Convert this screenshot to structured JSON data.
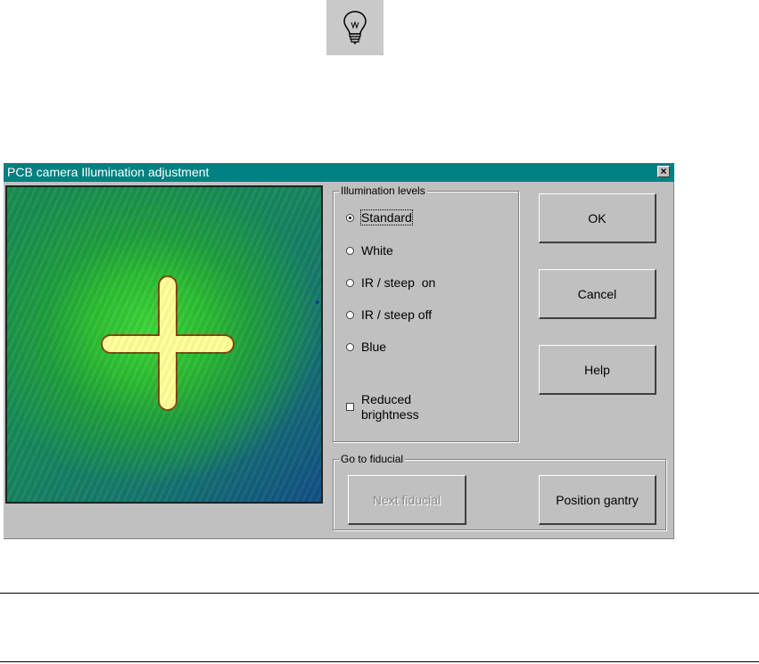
{
  "toolbar": {
    "icon": "light-bulb-icon"
  },
  "dialog": {
    "title": "PCB camera Illumination adjustment",
    "close_label": "×",
    "illumination": {
      "group_label": "Illumination levels",
      "options": [
        {
          "label": "Standard",
          "selected": true
        },
        {
          "label": "White",
          "selected": false
        },
        {
          "label": "IR / steep  on",
          "selected": false
        },
        {
          "label": "IR / steep off",
          "selected": false
        },
        {
          "label": "Blue",
          "selected": false
        }
      ],
      "reduced_brightness": {
        "label": "Reduced brightness",
        "checked": false
      }
    },
    "buttons": {
      "ok": "OK",
      "cancel": "Cancel",
      "help": "Help"
    },
    "fiducial": {
      "group_label": "Go to fiducial",
      "next_label": "Next fiducial",
      "position_label": "Position gantry"
    }
  },
  "colors": {
    "titlebar": "#008080",
    "dialog_bg": "#c0c0c0",
    "fiducial_fill": "#ffff99"
  }
}
